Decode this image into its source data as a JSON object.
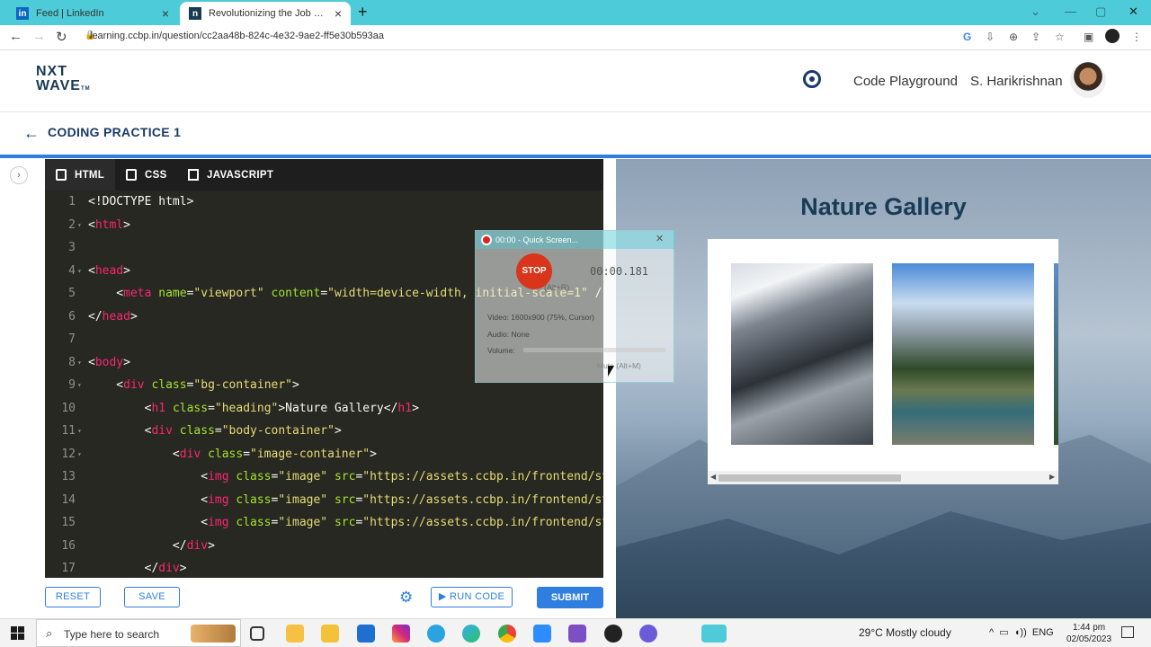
{
  "browser": {
    "tabs": [
      {
        "label": "Feed | LinkedIn",
        "favicon": "in"
      },
      {
        "label": "Revolutionizing the Job Market |",
        "favicon": "n"
      }
    ],
    "url": "learning.ccbp.in/question/cc2aa48b-824c-4e32-9ae2-ff5e30b593aa"
  },
  "header": {
    "logo_line1": "NXT",
    "logo_line2": "WAVE",
    "logo_tm": "TM",
    "playground_label": "Code Playground",
    "user_name": "S. Harikrishnan"
  },
  "subheader": {
    "title": "CODING PRACTICE 1"
  },
  "editor": {
    "tabs": [
      "HTML",
      "CSS",
      "JAVASCRIPT"
    ],
    "line_numbers": [
      "1",
      "2",
      "3",
      "4",
      "5",
      "6",
      "7",
      "8",
      "9",
      "10",
      "11",
      "12",
      "13",
      "14",
      "15",
      "16",
      "17"
    ]
  },
  "buttons": {
    "reset": "RESET",
    "save": "SAVE",
    "run": "▶ RUN CODE",
    "submit": "SUBMIT"
  },
  "preview": {
    "heading": "Nature Gallery"
  },
  "recorder": {
    "title": "00:00 - Quick Screen...",
    "stop": "STOP",
    "stop_hint": "(Alt+R)",
    "time": "00:00.181",
    "video": "Video: 1600x900 (75%, Cursor)",
    "audio": "Audio: None",
    "volume": "Volume:",
    "mute": "Mute (Alt+M)"
  },
  "taskbar": {
    "search_placeholder": "Type here to search",
    "weather": "29°C  Mostly cloudy",
    "lang": "ENG",
    "time": "1:44 pm",
    "date": "02/05/2023"
  },
  "colors": {
    "accent": "#2f7ee0",
    "brand_dark": "#183b56",
    "tab_bar": "#4ecbd8"
  }
}
